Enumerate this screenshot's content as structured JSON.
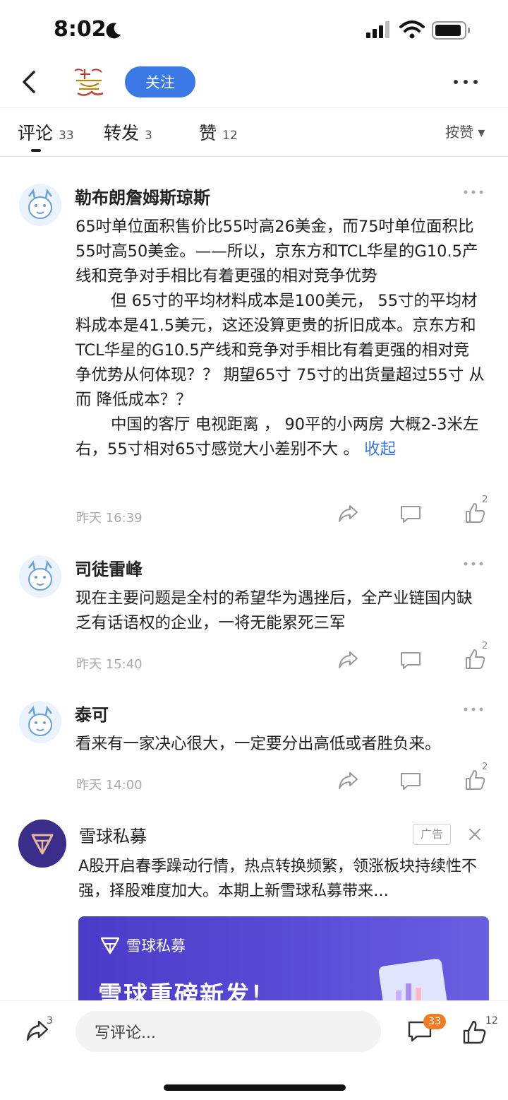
{
  "status_bar": {
    "time": "8:02"
  },
  "header": {
    "follow_label": "关注"
  },
  "tabs": [
    {
      "label": "评论",
      "count": "33"
    },
    {
      "label": "转发",
      "count": "3"
    },
    {
      "label": "赞",
      "count": "12"
    }
  ],
  "sort_label": "按赞 ▾",
  "comments": [
    {
      "name": "勒布朗詹姆斯琼斯",
      "paragraphs": [
        "65吋单位面积售价比55吋高26美金，而75吋单位面积比55吋高50美金。——所以，京东方和TCL华星的G10.5产线和竞争对手相比有着更强的相对竞争优势",
        "但 65寸的平均材料成本是100美元， 55寸的平均材料成本是41.5美元，这还没算更贵的折旧成本。京东方和TCL华星的G10.5产线和竞争对手相比有着更强的相对竞争优势从何体现？？ 期望65寸 75寸的出货量超过55寸 从而 降低成本？？",
        "中国的客厅 电视距离 ， 90平的小两房 大概2-3米左右，55寸相对65寸感觉大小差别不大 。 "
      ],
      "collapse_label": "收起",
      "time": "昨天 16:39",
      "likes": "2"
    },
    {
      "name": "司徒雷峰",
      "text": "现在主要问题是全村的希望华为遇挫后，全产业链国内缺乏有话语权的企业，一将无能累死三军",
      "time": "昨天 15:40",
      "likes": "2"
    },
    {
      "name": "泰可",
      "text": "看来有一家决心很大，一定要分出高低或者胜负来。",
      "time": "昨天 14:00",
      "likes": "2"
    }
  ],
  "ad": {
    "name": "雪球私募",
    "badge": "广告",
    "text": "A股开启春季躁动行情，热点转换频繁，领涨板块持续性不强，择股难度加大。本期上新雪球私募带来…",
    "banner_brand": "雪球私募",
    "banner_slogan": "雪球重磅新发！"
  },
  "bottom_bar": {
    "share_count": "3",
    "input_placeholder": "写评论...",
    "comment_count": "33",
    "like_count": "12"
  },
  "colors": {
    "accent": "#3a78e6",
    "badge": "#f07d24",
    "ad_purple": "#4a3bc9"
  }
}
